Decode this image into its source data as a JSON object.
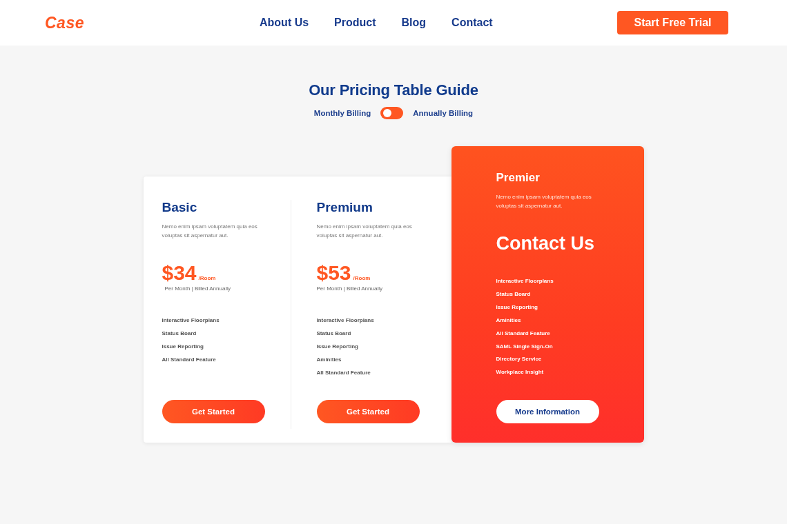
{
  "header": {
    "logo": "Case",
    "nav": [
      {
        "label": "About Us"
      },
      {
        "label": "Product"
      },
      {
        "label": "Blog"
      },
      {
        "label": "Contact"
      }
    ],
    "cta": "Start Free Trial"
  },
  "pricing": {
    "title": "Our Pricing Table Guide",
    "billing": {
      "monthly_label": "Monthly Billing",
      "annual_label": "Annually Billing",
      "on": false
    }
  },
  "plans": [
    {
      "kind": "standard",
      "name": "Basic",
      "description": "Nemo enim ipsam voluptatem quia eos voluptas sit aspernatur aut.",
      "price": "$34",
      "unit": "/Room",
      "billing_note": "Per Month | Billed Annually",
      "features": [
        "Interactive Floorplans",
        "Status Board",
        "Issue Reporting",
        "All Standard Feature"
      ],
      "button": "Get Started"
    },
    {
      "kind": "standard",
      "name": "Premium",
      "description": "Nemo enim ipsam voluptatem quia eos voluptas sit aspernatur aut.",
      "price": "$53",
      "unit": "/Room",
      "billing_note": "Per Month | Billed Annually",
      "features": [
        "Interactive Floorplans",
        "Status Board",
        "Issue Reporting",
        "Aminities",
        "All Standard Feature"
      ],
      "button": "Get Started"
    },
    {
      "kind": "featured",
      "name": "Premier",
      "description": "Nemo enim ipsam voluptatem quia eos voluptas sit aspernatur aut.",
      "headline": "Contact Us",
      "features": [
        "Interactive Floorplans",
        "Status Board",
        "Issue Reporting",
        "Aminities",
        "All Standard Feature",
        "SAML Single Sign-On",
        "Directory Service",
        "Workplace Insight"
      ],
      "button": "More Information"
    }
  ]
}
